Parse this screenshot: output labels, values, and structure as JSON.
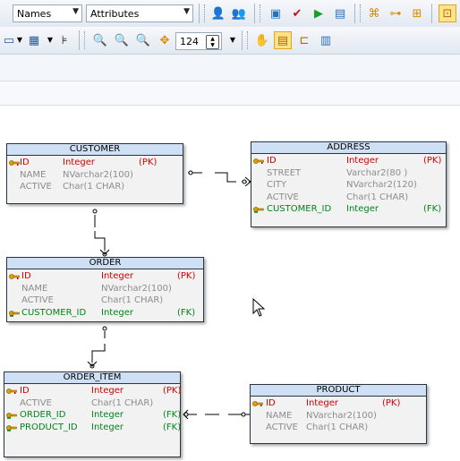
{
  "toolbar": {
    "names_combo": "Names",
    "attributes_combo": "Attributes",
    "zoom_value": "124"
  },
  "colors": {
    "pk": "#d40000",
    "fk": "#00841b",
    "attr": "#8c8c8c",
    "header": "#cfe0f4"
  },
  "entities": {
    "customer": {
      "title": "CUSTOMER",
      "rows": [
        {
          "name": "ID",
          "type": "Integer",
          "key": "(PK)"
        },
        {
          "name": "NAME",
          "type": "NVarchar2(100)",
          "key": ""
        },
        {
          "name": "ACTIVE",
          "type": "Char(1 CHAR)",
          "key": ""
        }
      ]
    },
    "address": {
      "title": "ADDRESS",
      "rows": [
        {
          "name": "ID",
          "type": "Integer",
          "key": "(PK)"
        },
        {
          "name": "STREET",
          "type": "Varchar2(80 )",
          "key": ""
        },
        {
          "name": "CITY",
          "type": "NVarchar2(120)",
          "key": ""
        },
        {
          "name": "ACTIVE",
          "type": "Char(1 CHAR)",
          "key": ""
        },
        {
          "name": "CUSTOMER_ID",
          "type": "Integer",
          "key": "(FK)"
        }
      ]
    },
    "order": {
      "title": "ORDER",
      "rows": [
        {
          "name": "ID",
          "type": "Integer",
          "key": "(PK)"
        },
        {
          "name": "NAME",
          "type": "NVarchar2(100)",
          "key": ""
        },
        {
          "name": "ACTIVE",
          "type": "Char(1 CHAR)",
          "key": ""
        },
        {
          "name": "CUSTOMER_ID",
          "type": "Integer",
          "key": "(FK)"
        }
      ]
    },
    "order_item": {
      "title": "ORDER_ITEM",
      "rows": [
        {
          "name": "ID",
          "type": "Integer",
          "key": "(PK)"
        },
        {
          "name": "ACTIVE",
          "type": "Char(1 CHAR)",
          "key": ""
        },
        {
          "name": "ORDER_ID",
          "type": "Integer",
          "key": "(FK)"
        },
        {
          "name": "PRODUCT_ID",
          "type": "Integer",
          "key": "(FK)"
        }
      ]
    },
    "product": {
      "title": "PRODUCT",
      "rows": [
        {
          "name": "ID",
          "type": "Integer",
          "key": "(PK)"
        },
        {
          "name": "NAME",
          "type": "NVarchar2(100)",
          "key": ""
        },
        {
          "name": "ACTIVE",
          "type": "Char(1 CHAR)",
          "key": ""
        }
      ]
    }
  }
}
